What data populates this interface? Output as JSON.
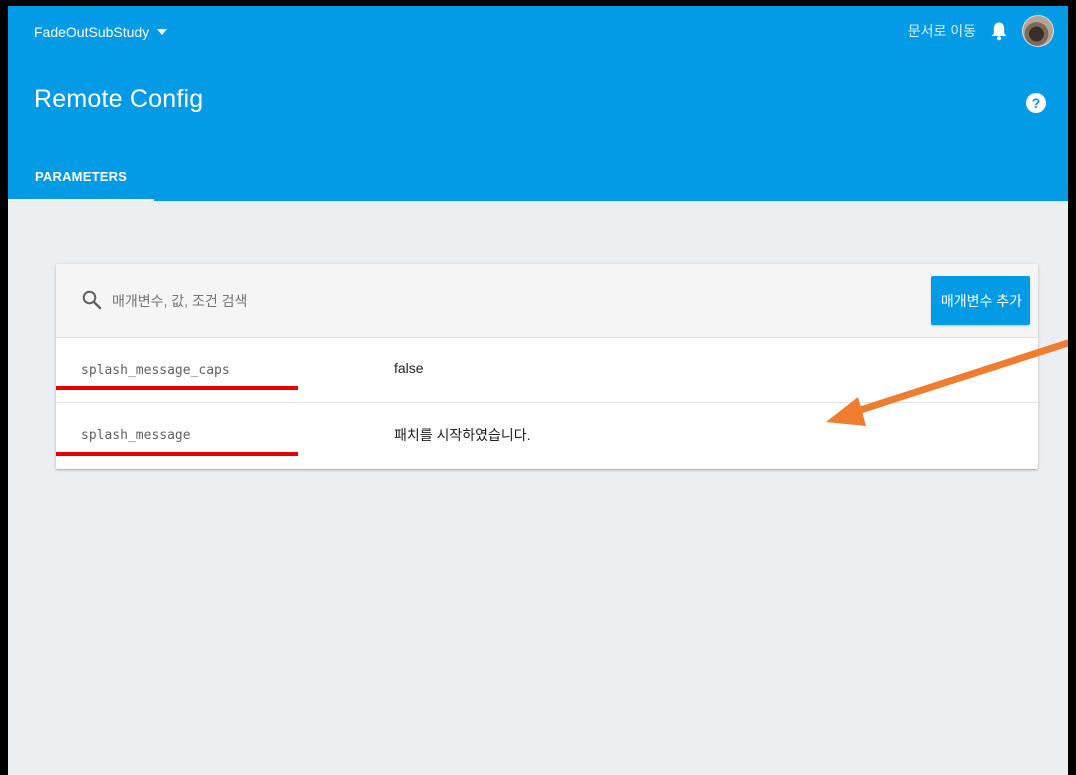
{
  "header": {
    "project_name": "FadeOutSubStudy",
    "docs_link": "문서로 이동",
    "page_title": "Remote Config",
    "help_label": "?",
    "tabs": [
      {
        "label": "PARAMETERS",
        "active": true
      }
    ]
  },
  "card": {
    "search_placeholder": "매개변수, 값, 조건 검색",
    "add_button_label": "매개변수 추가",
    "rows": [
      {
        "key": "splash_message_caps",
        "value": "false"
      },
      {
        "key": "splash_message",
        "value": "패치를 시작하였습니다."
      }
    ]
  },
  "icons": {
    "project_dropdown": "caret-down-icon",
    "notifications": "bell-icon",
    "account": "avatar",
    "help": "help-icon",
    "search": "search-icon"
  },
  "colors": {
    "primary": "#039be5",
    "background": "#eceff1",
    "underline_annotation": "#e60000",
    "arrow_annotation": "#f07c2f"
  }
}
